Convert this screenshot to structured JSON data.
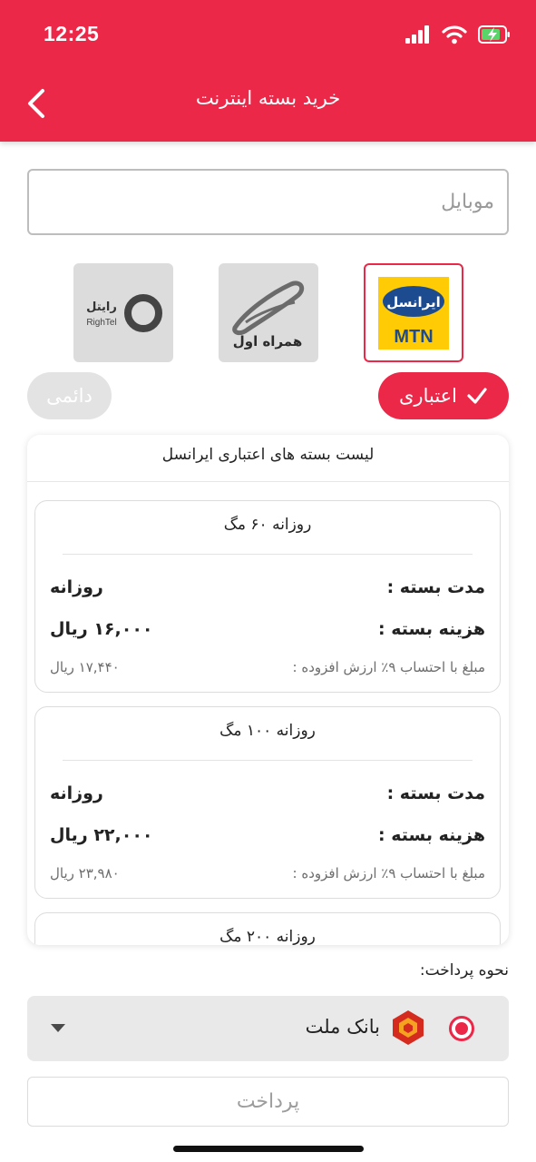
{
  "status_bar": {
    "time": "12:25"
  },
  "header": {
    "title": "خرید بسته اینترنت"
  },
  "mobile_field": {
    "placeholder": "موبایل",
    "value": ""
  },
  "operators": [
    {
      "id": "irancell",
      "logo_text_fa": "ایرانسل",
      "logo_text_en": "MTN",
      "selected": true
    },
    {
      "id": "hamrah-aval",
      "logo_text_fa": "همراه اول",
      "selected": false
    },
    {
      "id": "rightel",
      "logo_text_fa": "رایتل",
      "logo_text_en": "RighTel",
      "selected": false
    }
  ],
  "sim_types": {
    "credit": "اعتباری",
    "permanent": "دائمی",
    "selected": "credit"
  },
  "package_list": {
    "title": "لیست بسته های اعتباری ایرانسل",
    "packages": [
      {
        "title": "روزانه ۶۰ مگ",
        "duration_label": "مدت بسته :",
        "duration": "روزانه",
        "cost_label": "هزینه بسته :",
        "cost": "۱۶,۰۰۰ ریال",
        "vat_label": "مبلغ با احتساب ۹٪ ارزش افزوده :",
        "vat_cost": "۱۷,۴۴۰ ریال"
      },
      {
        "title": "روزانه ۱۰۰ مگ",
        "duration_label": "مدت بسته :",
        "duration": "روزانه",
        "cost_label": "هزینه بسته :",
        "cost": "۲۲,۰۰۰ ریال",
        "vat_label": "مبلغ با احتساب ۹٪ ارزش افزوده :",
        "vat_cost": "۲۳,۹۸۰ ریال"
      },
      {
        "title": "روزانه ۲۰۰ مگ"
      }
    ]
  },
  "payment": {
    "label": "نحوه پرداخت:",
    "bank": "بانک ملت",
    "pay_button": "پرداخت"
  },
  "colors": {
    "accent": "#EC2848",
    "irancell_yellow": "#FFCB05",
    "irancell_blue": "#1D4B8F"
  }
}
